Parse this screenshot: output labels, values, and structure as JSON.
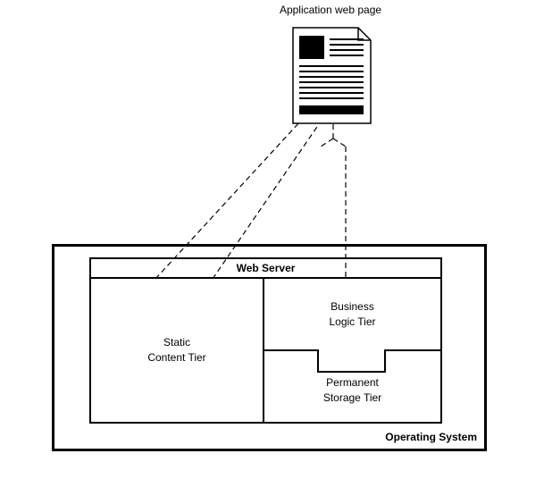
{
  "title": "Application web page",
  "os": {
    "caption": "Operating System"
  },
  "webserver": {
    "header": "Web Server",
    "static_tier": "Static\nContent Tier",
    "business_tier": "Business\nLogic Tier",
    "storage_tier": "Permanent\nStorage Tier"
  }
}
